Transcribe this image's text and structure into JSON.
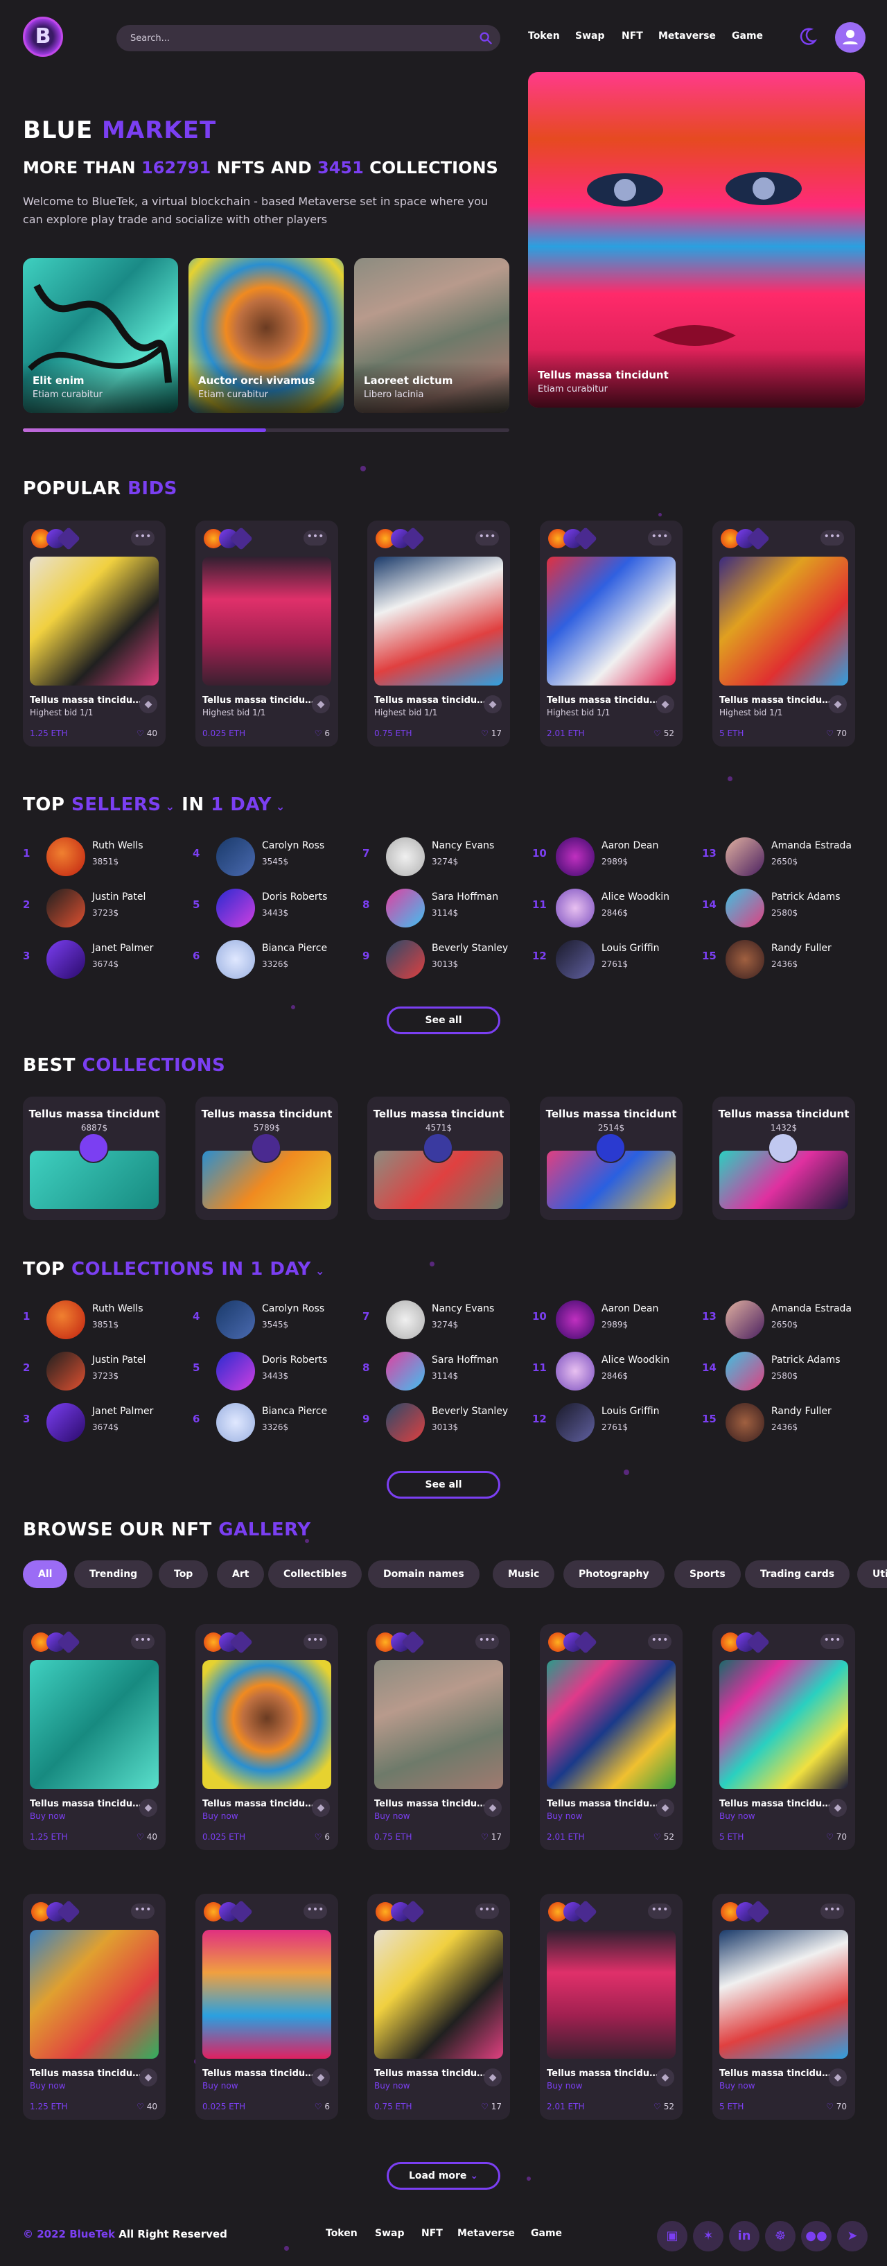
{
  "header": {
    "logo_letter": "B",
    "search_placeholder": "Search...",
    "nav": [
      "Token",
      "Swap",
      "NFT",
      "Metaverse",
      "Game"
    ]
  },
  "hero": {
    "title_a": "BLUE",
    "title_b": "MARKET",
    "sub_a": "MORE THAN",
    "nfts": "162791",
    "sub_b": "NFTS AND",
    "collections": "3451",
    "sub_c": "COLLECTIONS",
    "desc": "Welcome to BlueTek, a virtual blockchain - based Metaverse set in space where you can explore play trade and socialize with other players",
    "slides": [
      {
        "title": "Elit enim",
        "subtitle": "Etiam curabitur"
      },
      {
        "title": "Auctor orci vivamus",
        "subtitle": "Etiam curabitur"
      },
      {
        "title": "Laoreet dictum",
        "subtitle": "Libero lacinia"
      }
    ],
    "feature": {
      "title": "Tellus massa tincidunt",
      "subtitle": "Etiam curabitur"
    },
    "progress": 0.5
  },
  "popular": {
    "title_a": "POPULAR",
    "title_b": "BIDS",
    "more": "•••",
    "items": [
      {
        "name": "Tellus massa tincidunt",
        "bid": "Highest bid 1/1",
        "eth": "1.25 ETH",
        "likes": "40"
      },
      {
        "name": "Tellus massa tincidunt",
        "bid": "Highest bid 1/1",
        "eth": "0.025 ETH",
        "likes": "6"
      },
      {
        "name": "Tellus massa tincidunt",
        "bid": "Highest bid 1/1",
        "eth": "0.75 ETH",
        "likes": "17"
      },
      {
        "name": "Tellus massa tincidunt",
        "bid": "Highest bid 1/1",
        "eth": "2.01 ETH",
        "likes": "52"
      },
      {
        "name": "Tellus massa tincidunt",
        "bid": "Highest bid 1/1",
        "eth": "5 ETH",
        "likes": "70"
      }
    ]
  },
  "sellers": {
    "title_a": "TOP",
    "title_b": "SELLERS",
    "title_c": "IN",
    "title_d": "1 DAY",
    "see_all": "See all",
    "list": [
      {
        "rank": "1",
        "name": "Ruth Wells",
        "value": "3851$"
      },
      {
        "rank": "2",
        "name": "Justin Patel",
        "value": "3723$"
      },
      {
        "rank": "3",
        "name": "Janet Palmer",
        "value": "3674$"
      },
      {
        "rank": "4",
        "name": "Carolyn Ross",
        "value": "3545$"
      },
      {
        "rank": "5",
        "name": "Doris Roberts",
        "value": "3443$"
      },
      {
        "rank": "6",
        "name": "Bianca Pierce",
        "value": "3326$"
      },
      {
        "rank": "7",
        "name": "Nancy Evans",
        "value": "3274$"
      },
      {
        "rank": "8",
        "name": "Sara Hoffman",
        "value": "3114$"
      },
      {
        "rank": "9",
        "name": "Beverly Stanley",
        "value": "3013$"
      },
      {
        "rank": "10",
        "name": "Aaron Dean",
        "value": "2989$"
      },
      {
        "rank": "11",
        "name": "Alice Woodkin",
        "value": "2846$"
      },
      {
        "rank": "12",
        "name": "Louis Griffin",
        "value": "2761$"
      },
      {
        "rank": "13",
        "name": "Amanda Estrada",
        "value": "2650$"
      },
      {
        "rank": "14",
        "name": "Patrick Adams",
        "value": "2580$"
      },
      {
        "rank": "15",
        "name": "Randy Fuller",
        "value": "2436$"
      }
    ]
  },
  "best": {
    "title_a": "BEST",
    "title_b": "COLLECTIONS",
    "items": [
      {
        "title": "Tellus massa tincidunt",
        "value": "6887$"
      },
      {
        "title": "Tellus massa tincidunt",
        "value": "5789$"
      },
      {
        "title": "Tellus massa tincidunt",
        "value": "4571$"
      },
      {
        "title": "Tellus massa tincidunt",
        "value": "2514$"
      },
      {
        "title": "Tellus massa tincidunt",
        "value": "1432$"
      }
    ]
  },
  "topcoll": {
    "title_a": "TOP",
    "title_b": "COLLECTIONS",
    "title_c": "IN",
    "title_d": "1 DAY",
    "see_all": "See all"
  },
  "gallery": {
    "title_a": "BROWSE OUR NFT",
    "title_b": "GALLERY",
    "chips": [
      "All",
      "Trending",
      "Top",
      "Art",
      "Collectibles",
      "Domain names",
      "Music",
      "Photography",
      "Sports",
      "Trading cards",
      "Utility"
    ],
    "buy": "Buy now",
    "items": [
      {
        "name": "Tellus massa tincidunt",
        "eth": "1.25 ETH",
        "likes": "40"
      },
      {
        "name": "Tellus massa tincidunt",
        "eth": "0.025 ETH",
        "likes": "6"
      },
      {
        "name": "Tellus massa tincidunt",
        "eth": "0.75 ETH",
        "likes": "17"
      },
      {
        "name": "Tellus massa tincidunt",
        "eth": "2.01 ETH",
        "likes": "52"
      },
      {
        "name": "Tellus massa tincidunt",
        "eth": "5 ETH",
        "likes": "70"
      },
      {
        "name": "Tellus massa tincidunt",
        "eth": "1.25 ETH",
        "likes": "40"
      },
      {
        "name": "Tellus massa tincidunt",
        "eth": "0.025 ETH",
        "likes": "6"
      },
      {
        "name": "Tellus massa tincidunt",
        "eth": "0.75 ETH",
        "likes": "17"
      },
      {
        "name": "Tellus massa tincidunt",
        "eth": "2.01 ETH",
        "likes": "52"
      },
      {
        "name": "Tellus massa tincidunt",
        "eth": "5 ETH",
        "likes": "70"
      }
    ],
    "load_more": "Load more"
  },
  "footer": {
    "copy_a": "© 2022",
    "brand": "BlueTek",
    "copy_b": "All Right Reserved",
    "nav": [
      "Token",
      "Swap",
      "NFT",
      "Metaverse",
      "Game"
    ],
    "social_icons": [
      "twitch-icon",
      "twitter-icon",
      "linkedin-icon",
      "reddit-icon",
      "medium-icon",
      "telegram-icon"
    ],
    "social_glyphs": [
      "▣",
      "✶",
      "in",
      "☸",
      "●●",
      "➤"
    ]
  },
  "colors": {
    "accent": "#7b3ff2",
    "background": "#1e1c20",
    "card": "#2b2530"
  }
}
